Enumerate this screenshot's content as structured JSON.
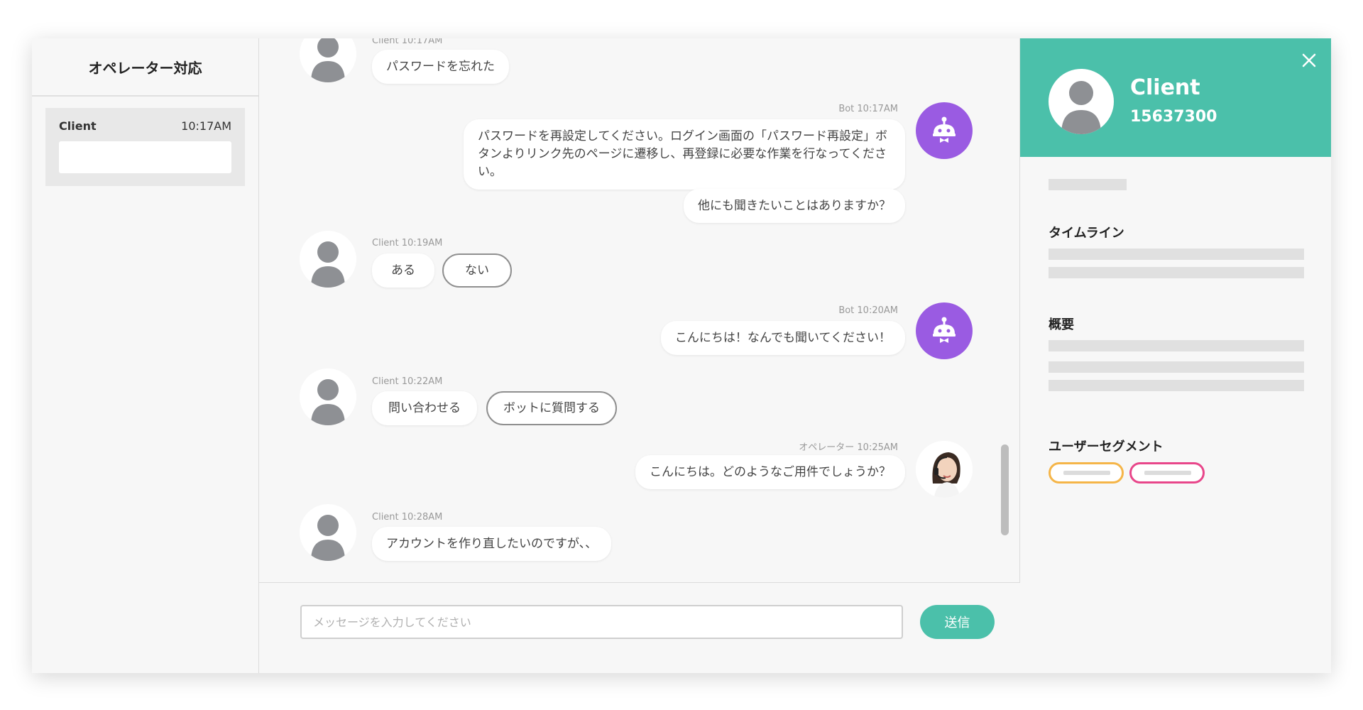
{
  "sidebar": {
    "title": "オペレーター対応",
    "conversations": [
      {
        "name": "Client",
        "time": "10:17AM"
      }
    ]
  },
  "chat": {
    "messages": [
      {
        "meta": "Client 10:17AM",
        "text": "パスワードを忘れた"
      },
      {
        "meta": "Bot 10:17AM",
        "text": "パスワードを再設定してください。ログイン画面の「パスワード再設定」ボタンよりリンク先のページに遷移し、再登録に必要な作業を行なってください。",
        "text2": "他にも聞きたいことはありますか？"
      },
      {
        "meta": "Client 10:19AM",
        "choices": [
          "ある",
          "ない"
        ]
      },
      {
        "meta": "Bot 10:20AM",
        "text": "こんにちは！なんでも聞いてください！"
      },
      {
        "meta": "Client 10:22AM",
        "choices": [
          "問い合わせる",
          "ボットに質問する"
        ]
      },
      {
        "meta": "オペレーター 10:25AM",
        "text": "こんにちは。どのようなご用件でしょうか？"
      },
      {
        "meta": "Client 10:28AM",
        "text": "アカウントを作り直したいのですが、、"
      }
    ],
    "input_placeholder": "メッセージを入力してください",
    "send_label": "送信"
  },
  "profile": {
    "name": "Client",
    "id": "15637300",
    "sections": {
      "timeline": "タイムライン",
      "summary": "概要",
      "segments": "ユーザーセグメント"
    }
  },
  "colors": {
    "accent": "#4bc0aa",
    "bot": "#9a5be2",
    "segment_orange": "#f5b548",
    "segment_pink": "#e8468a"
  }
}
